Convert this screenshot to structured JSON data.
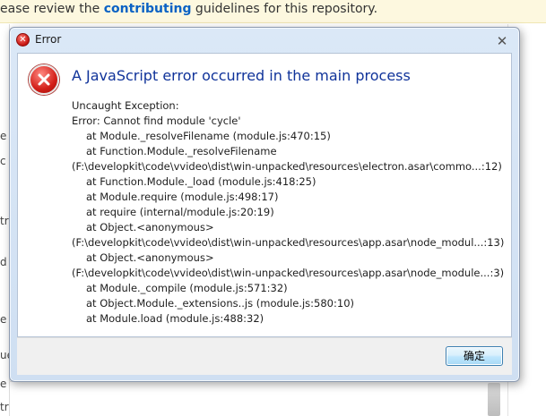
{
  "background": {
    "banner_prefix": "ease review the ",
    "banner_link": "contributing",
    "banner_suffix": " guidelines for this repository.",
    "left_fragments": [
      "e",
      "c",
      "tr",
      "d",
      "e",
      "ue",
      "e",
      "tr"
    ]
  },
  "dialog": {
    "title": "Error",
    "main_instruction": "A JavaScript error occurred in the main process",
    "detail_lines": [
      {
        "text": "Uncaught Exception:",
        "indent": false
      },
      {
        "text": "Error: Cannot find module 'cycle'",
        "indent": false
      },
      {
        "text": "at Module._resolveFilename (module.js:470:15)",
        "indent": true
      },
      {
        "text": "at Function.Module._resolveFilename",
        "indent": true
      },
      {
        "text": "(F:\\developkit\\code\\vvideo\\dist\\win-unpacked\\resources\\electron.asar\\commo...:12)",
        "indent": false
      },
      {
        "text": "at Function.Module._load (module.js:418:25)",
        "indent": true
      },
      {
        "text": "at Module.require (module.js:498:17)",
        "indent": true
      },
      {
        "text": "at require (internal/module.js:20:19)",
        "indent": true
      },
      {
        "text": "at Object.<anonymous>",
        "indent": true
      },
      {
        "text": "(F:\\developkit\\code\\vvideo\\dist\\win-unpacked\\resources\\app.asar\\node_modul...:13)",
        "indent": false
      },
      {
        "text": "at Object.<anonymous>",
        "indent": true
      },
      {
        "text": "(F:\\developkit\\code\\vvideo\\dist\\win-unpacked\\resources\\app.asar\\node_module...:3)",
        "indent": false
      },
      {
        "text": "at Module._compile (module.js:571:32)",
        "indent": true
      },
      {
        "text": "at Object.Module._extensions..js (module.js:580:10)",
        "indent": true
      },
      {
        "text": "at Module.load (module.js:488:32)",
        "indent": true
      }
    ],
    "ok_label": "确定",
    "close_glyph": "✕",
    "icon": "error-icon"
  }
}
